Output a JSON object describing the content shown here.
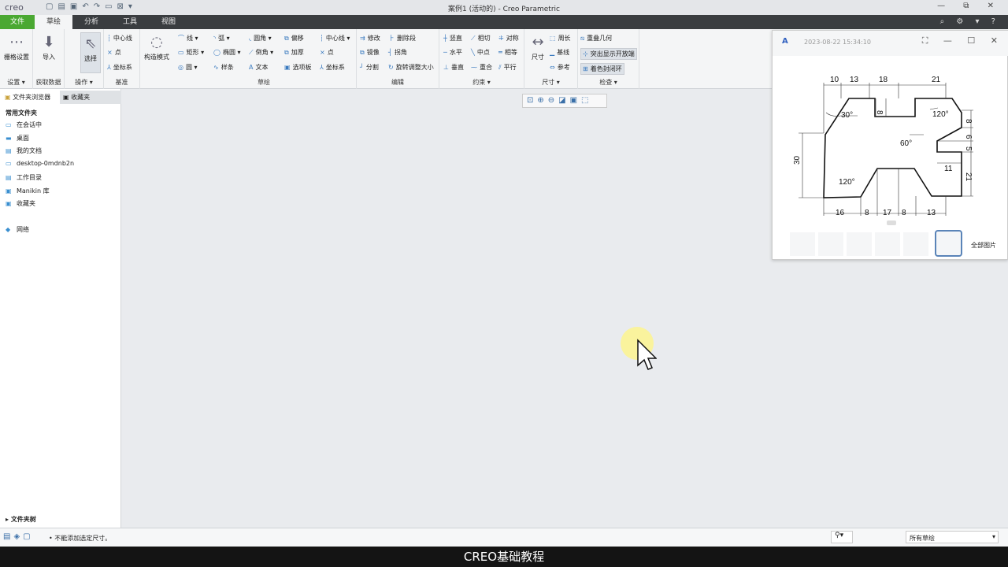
{
  "app": {
    "logo": "creo",
    "title": "案例1 (活动的) - Creo Parametric",
    "window_controls": "— ⧉ ✕"
  },
  "tabs": [
    {
      "label": "文件"
    },
    {
      "label": "草绘"
    },
    {
      "label": "分析"
    },
    {
      "label": "工具"
    },
    {
      "label": "视图"
    }
  ],
  "ribbon": {
    "setup": {
      "grid": "栅格设置",
      "label": "设置 ▾"
    },
    "getdata": {
      "import": "导入",
      "label": "获取数据"
    },
    "ops": {
      "select": "选择",
      "label": "操作 ▾"
    },
    "datum": {
      "centerline": "中心线",
      "point": "点",
      "csys": "坐标系",
      "label": "基准"
    },
    "construct": {
      "mode": "构造模式"
    },
    "sketch": {
      "items": [
        "线 ▾",
        "弧 ▾",
        "圆角 ▾",
        "偏移",
        "中心线 ▾",
        "矩形 ▾",
        "椭圆 ▾",
        "倒角 ▾",
        "加厚",
        "点",
        "圆 ▾",
        "样条",
        "文本",
        "选项板",
        "坐标系"
      ],
      "label": "草绘"
    },
    "edit": {
      "items": [
        "修改",
        "删除段",
        "镜像",
        "拐角",
        "分割",
        "旋转调整大小"
      ],
      "label": "编辑"
    },
    "constrain": {
      "items": [
        "竖直",
        "相切",
        "对称",
        "水平",
        "中点",
        "相等",
        "垂直",
        "重合",
        "平行"
      ],
      "label": "约束 ▾"
    },
    "dimension": {
      "dim": "尺寸",
      "items": [
        "周长",
        "基线",
        "参考"
      ],
      "label": "尺寸 ▾"
    },
    "inspect": {
      "items": [
        "重叠几何",
        "突出显示开放端",
        "着色封闭环"
      ],
      "label": "检查 ▾"
    }
  },
  "sidebar": {
    "tabs": [
      "文件夹浏览器",
      "收藏夹"
    ],
    "heading": "常用文件夹",
    "items": [
      "在会话中",
      "桌面",
      "我的文档",
      "desktop-0mdnb2n",
      "工作目录",
      "Manikin 库",
      "收藏夹"
    ],
    "network": "网络",
    "tree": "文件夹树"
  },
  "status": {
    "message": "• 不能添加选定尺寸。",
    "filter": "所有草绘"
  },
  "viewer": {
    "title": "2023-08-22 15:34:10",
    "all_images": "全部图片",
    "dims": [
      "10",
      "13",
      "18",
      "21",
      "8",
      "30°",
      "120°",
      "8",
      "6",
      "5",
      "60°",
      "11",
      "21",
      "30",
      "120°",
      "16",
      "8",
      "17",
      "8",
      "13"
    ]
  },
  "caption": "CREO基础教程"
}
